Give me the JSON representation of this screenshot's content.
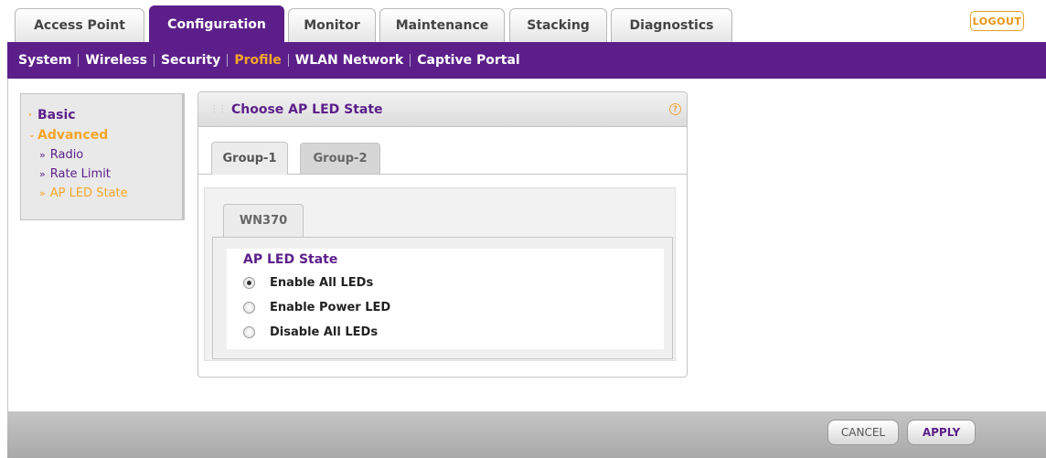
{
  "top_tabs": [
    {
      "label": "Access Point",
      "active": false
    },
    {
      "label": "Configuration",
      "active": true
    },
    {
      "label": "Monitor",
      "active": false
    },
    {
      "label": "Maintenance",
      "active": false
    },
    {
      "label": "Stacking",
      "active": false
    },
    {
      "label": "Diagnostics",
      "active": false
    }
  ],
  "logout_label": "LOGOUT",
  "sub_nav": [
    {
      "label": "System",
      "active": false
    },
    {
      "label": "Wireless",
      "active": false
    },
    {
      "label": "Security",
      "active": false
    },
    {
      "label": "Profile",
      "active": true
    },
    {
      "label": "WLAN Network",
      "active": false
    },
    {
      "label": "Captive Portal",
      "active": false
    }
  ],
  "left_menu": {
    "basic": "Basic",
    "advanced": "Advanced",
    "sub_items": [
      {
        "label": "Radio",
        "active": false
      },
      {
        "label": "Rate Limit",
        "active": false
      },
      {
        "label": "AP LED State",
        "active": true
      }
    ]
  },
  "panel": {
    "title": "Choose AP LED State",
    "help_icon": "?",
    "group_tabs": [
      {
        "label": "Group-1",
        "active": true
      },
      {
        "label": "Group-2",
        "active": false
      }
    ],
    "model_tab": "WN370",
    "section_title": "AP LED State",
    "options": [
      {
        "label": "Enable All LEDs",
        "checked": true
      },
      {
        "label": "Enable Power LED",
        "checked": false
      },
      {
        "label": "Disable All LEDs",
        "checked": false
      }
    ]
  },
  "buttons": {
    "cancel": "CANCEL",
    "apply": "APPLY"
  },
  "colors": {
    "brand_purple": "#5c1f8a",
    "accent_orange": "#f7a628"
  }
}
